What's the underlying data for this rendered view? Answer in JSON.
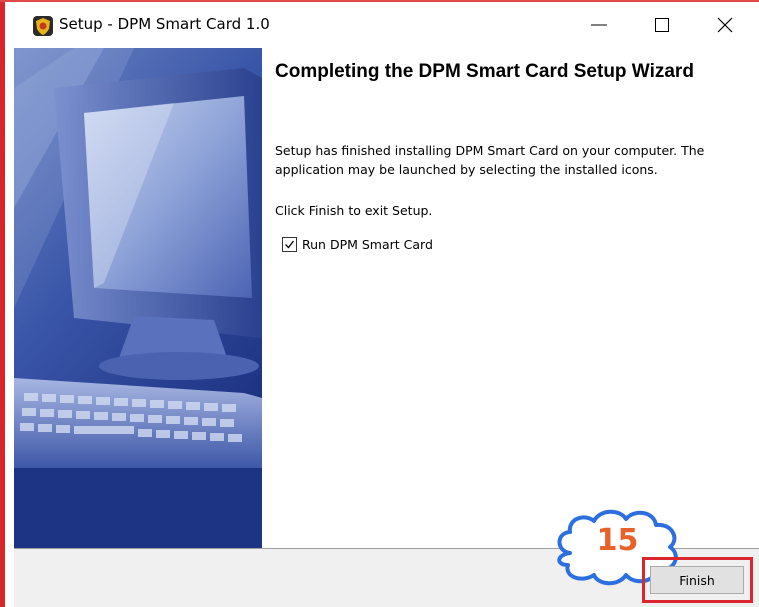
{
  "window": {
    "title": "Setup - DPM Smart Card 1.0",
    "app_icon": "setup-shield-icon",
    "controls": {
      "minimize_icon": "minimize-icon",
      "maximize_icon": "maximize-icon",
      "close_icon": "close-icon"
    }
  },
  "wizard": {
    "image": "computer-monitor-keyboard-illustration",
    "heading": "Completing the DPM Smart Card Setup Wizard",
    "description": "Setup has finished installing DPM Smart Card on your computer. The application may be launched by selecting the installed icons.",
    "exit_note": "Click Finish to exit Setup.",
    "run_option": {
      "label": "Run DPM Smart Card",
      "checked": true
    }
  },
  "footer": {
    "finish_label": "Finish"
  },
  "annotation": {
    "step_number": "15",
    "highlight_color": "#d9272d",
    "cloud_color": "#2e6fe0",
    "number_color": "#e8612a"
  }
}
